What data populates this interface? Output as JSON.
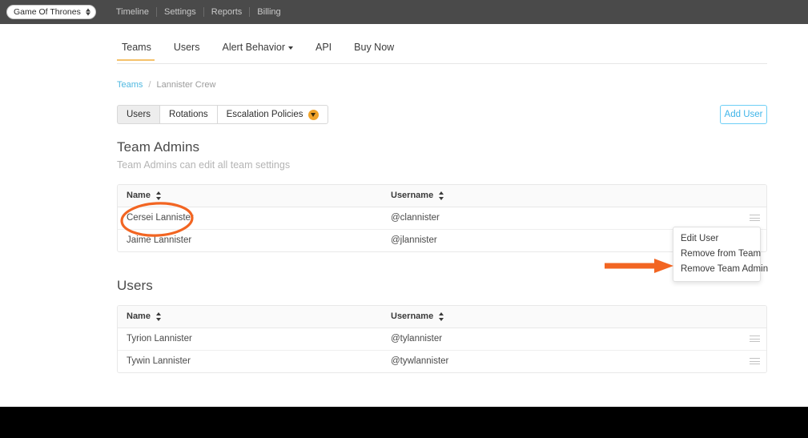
{
  "topnav": {
    "org_selector": {
      "label": "Game Of Thrones",
      "icon": "stepper-updown-icon"
    },
    "links": [
      "Timeline",
      "Settings",
      "Reports",
      "Billing"
    ]
  },
  "main_tabs": [
    {
      "label": "Teams",
      "active": true,
      "has_caret": false
    },
    {
      "label": "Users",
      "active": false,
      "has_caret": false
    },
    {
      "label": "Alert Behavior",
      "active": false,
      "has_caret": true
    },
    {
      "label": "API",
      "active": false,
      "has_caret": false
    },
    {
      "label": "Buy Now",
      "active": false,
      "has_caret": false
    }
  ],
  "breadcrumb": {
    "root": "Teams",
    "separator": "/",
    "current": "Lannister Crew"
  },
  "sub_tabs": [
    {
      "label": "Users",
      "active": true,
      "badge": false
    },
    {
      "label": "Rotations",
      "active": false,
      "badge": false
    },
    {
      "label": "Escalation Policies",
      "active": false,
      "badge": true
    }
  ],
  "add_user_button": "Add User",
  "team_admins": {
    "title": "Team Admins",
    "subtitle": "Team Admins can edit all team settings",
    "columns": [
      "Name",
      "Username"
    ],
    "rows": [
      {
        "name": "Cersei Lannister",
        "username": "@clannister"
      },
      {
        "name": "Jaime Lannister",
        "username": "@jlannister"
      }
    ]
  },
  "users": {
    "title": "Users",
    "columns": [
      "Name",
      "Username"
    ],
    "rows": [
      {
        "name": "Tyrion Lannister",
        "username": "@tylannister"
      },
      {
        "name": "Tywin Lannister",
        "username": "@tywlannister"
      }
    ]
  },
  "row_menu": {
    "items": [
      "Edit User",
      "Remove from Team",
      "Remove Team Admin"
    ]
  },
  "annotations": {
    "ellipse_target": "Cersei Lannister",
    "arrow_target": "Remove Team Admin",
    "color": "#F26522"
  },
  "colors": {
    "topnav_bg": "#4A4A4A",
    "accent_orange": "#F0A32A",
    "annotation_orange": "#F26522",
    "link_blue": "#4FB8E0",
    "tab_underline": "#F5C26B",
    "footer_bg": "#000000"
  }
}
